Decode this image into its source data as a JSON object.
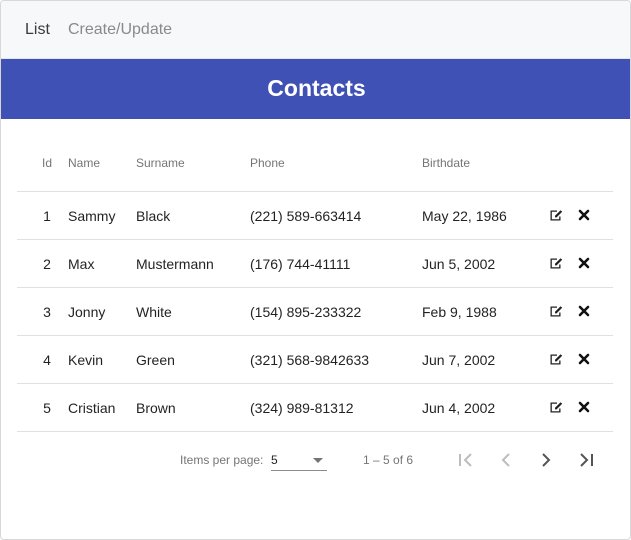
{
  "nav": {
    "list_label": "List",
    "create_label": "Create/Update"
  },
  "banner": {
    "title": "Contacts",
    "color": "#3f51b5"
  },
  "table": {
    "headers": {
      "id": "Id",
      "name": "Name",
      "surname": "Surname",
      "phone": "Phone",
      "birthdate": "Birthdate"
    },
    "rows": [
      {
        "id": "1",
        "name": "Sammy",
        "surname": "Black",
        "phone": "(221) 589-663414",
        "birthdate": "May 22, 1986"
      },
      {
        "id": "2",
        "name": "Max",
        "surname": "Mustermann",
        "phone": "(176) 744-41111",
        "birthdate": "Jun 5, 2002"
      },
      {
        "id": "3",
        "name": "Jonny",
        "surname": "White",
        "phone": "(154) 895-233322",
        "birthdate": "Feb 9, 1988"
      },
      {
        "id": "4",
        "name": "Kevin",
        "surname": "Green",
        "phone": "(321) 568-9842633",
        "birthdate": "Jun 7, 2002"
      },
      {
        "id": "5",
        "name": "Cristian",
        "surname": "Brown",
        "phone": "(324) 989-81312",
        "birthdate": "Jun 4, 2002"
      }
    ],
    "row_actions": {
      "edit_icon": "edit-icon",
      "delete_icon": "close-icon"
    }
  },
  "paginator": {
    "items_per_page_label": "Items per page:",
    "page_size": "5",
    "range_label": "1 – 5 of 6",
    "buttons": {
      "first": "first-page-icon",
      "prev": "chevron-left-icon",
      "next": "chevron-right-icon",
      "last": "last-page-icon"
    }
  }
}
